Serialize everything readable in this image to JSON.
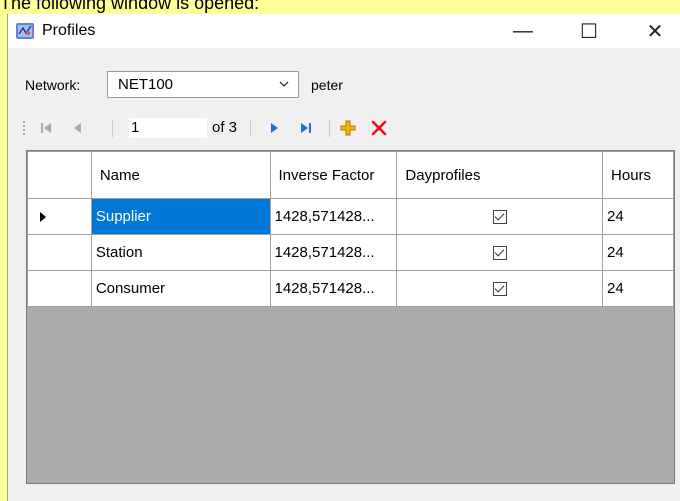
{
  "caption": "The following window is opened:",
  "window": {
    "title": "Profiles",
    "minimize": "—",
    "maximize": "☐",
    "close": "✕"
  },
  "network": {
    "label": "Network:",
    "selected": "NET100",
    "user": "peter"
  },
  "navigator": {
    "position": "1",
    "of_text": "of 3",
    "icons": [
      "move-first-icon",
      "move-previous-icon",
      "move-next-icon",
      "move-last-icon",
      "add-new-icon",
      "delete-icon"
    ]
  },
  "grid": {
    "columns": [
      "Name",
      "Inverse Factor",
      "Dayprofiles",
      "Hours"
    ],
    "rows": [
      {
        "name": "Supplier",
        "factor": "1428,571428...",
        "dayprofiles": true,
        "hours": "24"
      },
      {
        "name": "Station",
        "factor": "1428,571428...",
        "dayprofiles": true,
        "hours": "24"
      },
      {
        "name": "Consumer",
        "factor": "1428,571428...",
        "dayprofiles": true,
        "hours": "24"
      }
    ]
  },
  "colors": {
    "caption_bg": "#ffff99",
    "selection": "#0078d7",
    "delete_red": "#e81123",
    "add_yellow": "#f4b400",
    "nav_blue": "#1f6fd1"
  }
}
